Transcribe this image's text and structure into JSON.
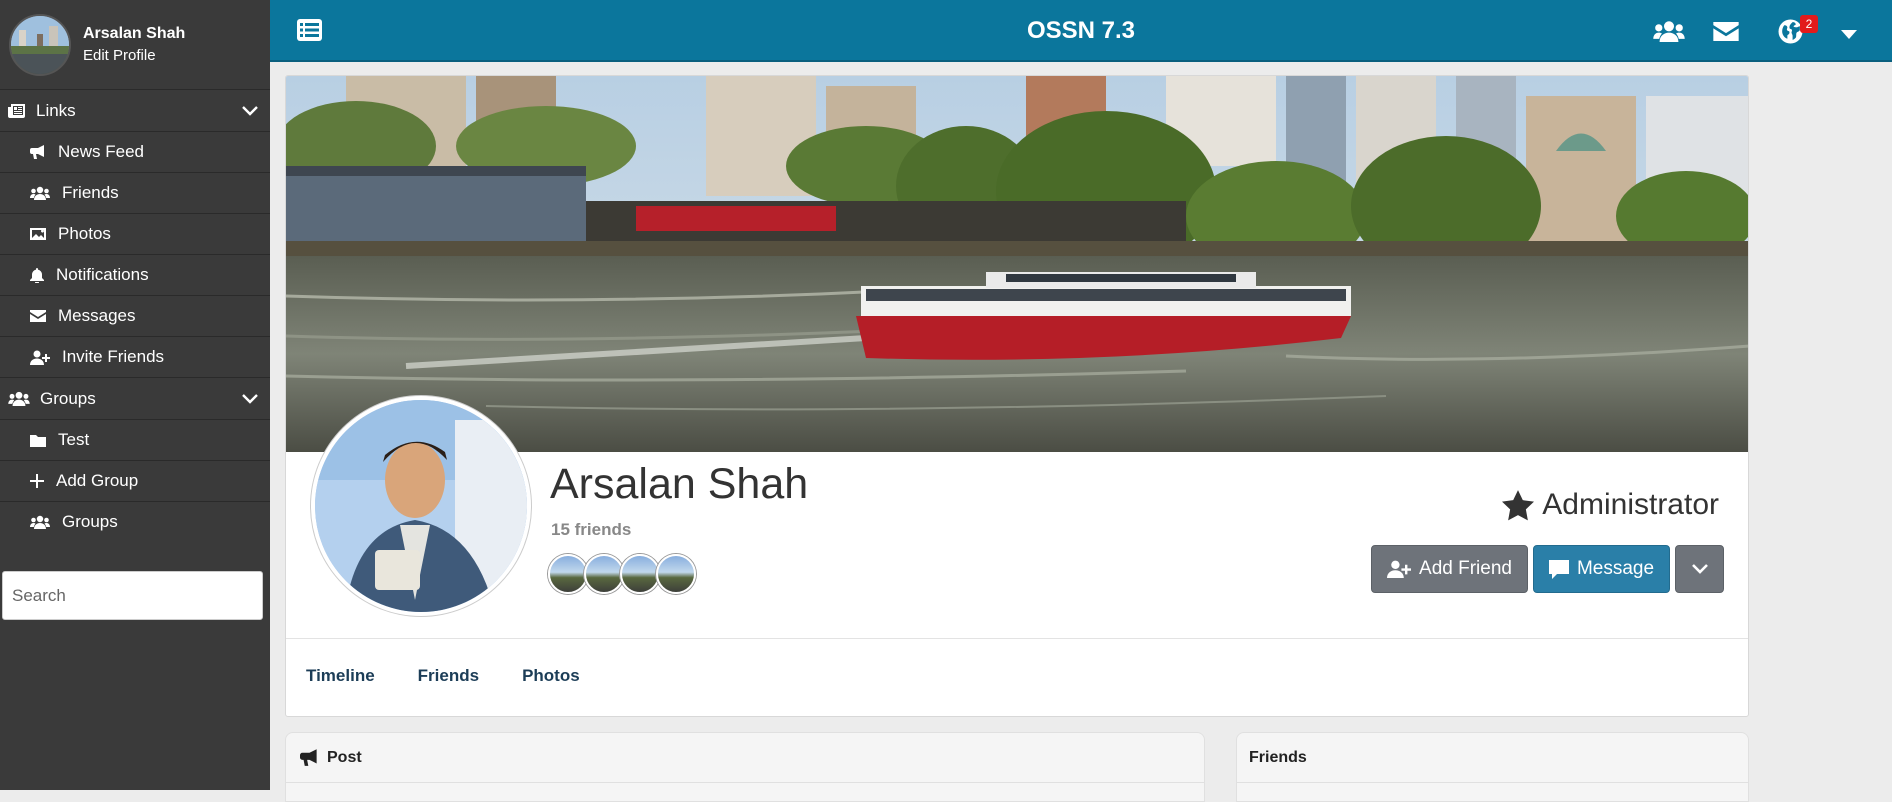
{
  "sidebar": {
    "user": {
      "name": "Arsalan Shah",
      "edit": "Edit Profile"
    },
    "sections": [
      {
        "label": "Links",
        "icon": "newspaper-icon",
        "items": [
          {
            "label": "News Feed",
            "icon": "bullhorn-icon"
          },
          {
            "label": "Friends",
            "icon": "users-icon"
          },
          {
            "label": "Photos",
            "icon": "image-icon"
          },
          {
            "label": "Notifications",
            "icon": "bell-icon"
          },
          {
            "label": "Messages",
            "icon": "envelope-icon"
          },
          {
            "label": "Invite Friends",
            "icon": "user-plus-icon"
          }
        ]
      },
      {
        "label": "Groups",
        "icon": "users-icon",
        "items": [
          {
            "label": "Test",
            "icon": "folder-icon"
          },
          {
            "label": "Add Group",
            "icon": "plus-icon"
          },
          {
            "label": "Groups",
            "icon": "users-icon"
          }
        ]
      }
    ],
    "search": {
      "placeholder": "Search"
    }
  },
  "topbar": {
    "title": "OSSN 7.3",
    "notification_count": "2",
    "icons": [
      "menu-list-icon",
      "users-icon",
      "envelope-icon",
      "globe-icon",
      "caret-down-icon"
    ],
    "color": "#0b769c"
  },
  "profile": {
    "name": "Arsalan Shah",
    "friends_count_text": "15 friends",
    "role": "Administrator",
    "buttons": {
      "add_friend": "Add Friend",
      "message": "Message"
    },
    "tabs": [
      "Timeline",
      "Friends",
      "Photos"
    ]
  },
  "panels": {
    "post": "Post",
    "friends": "Friends"
  }
}
